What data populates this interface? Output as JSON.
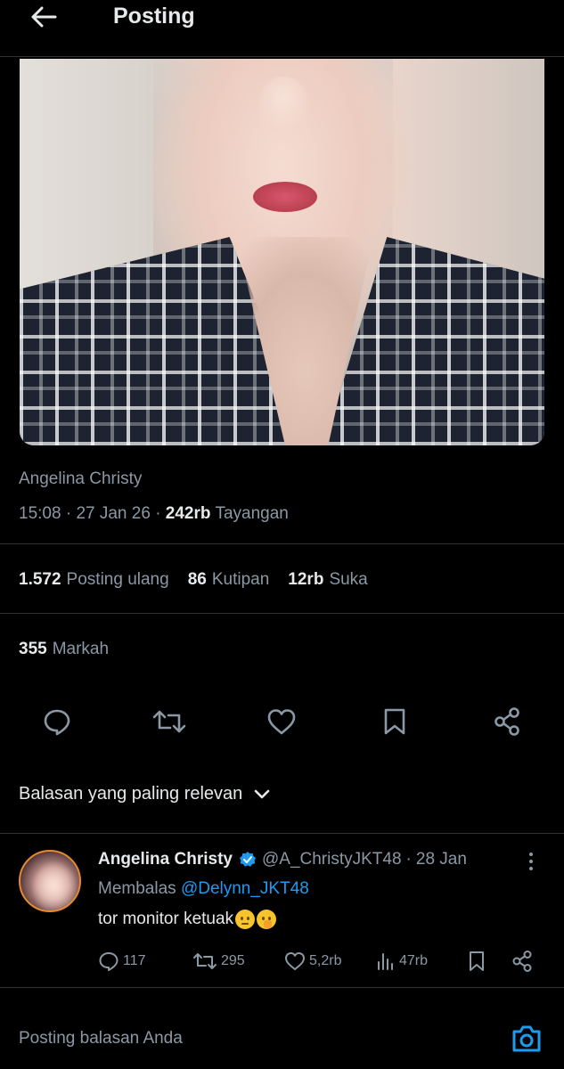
{
  "header": {
    "title": "Posting",
    "back_icon": "arrow-left-icon"
  },
  "post": {
    "author": "Angelina Christy",
    "time": "15:08",
    "date": "27 Jan 26",
    "separator": "·",
    "views_count": "242rb",
    "views_label": "Tayangan",
    "stats": [
      {
        "count": "1.572",
        "label": "Posting ulang"
      },
      {
        "count": "86",
        "label": "Kutipan"
      },
      {
        "count": "12rb",
        "label": "Suka"
      }
    ],
    "bookmarks": {
      "count": "355",
      "label": "Markah"
    },
    "actions": [
      "reply-icon",
      "repost-icon",
      "like-icon",
      "bookmark-icon",
      "share-icon"
    ]
  },
  "sort": {
    "label": "Balasan yang paling relevan",
    "icon": "chevron-down-icon"
  },
  "reply": {
    "name": "Angelina Christy",
    "handle": "@A_ChristyJKT48",
    "dot": "·",
    "date": "28 Jan",
    "replying_prefix": "Membalas",
    "replying_to": "@Delynn_JKT48",
    "text": "tor monitor ketuak",
    "actions": {
      "replies": "117",
      "reposts": "295",
      "likes": "5,2rb",
      "views": "47rb"
    }
  },
  "composer": {
    "placeholder": "Posting balasan Anda"
  },
  "colors": {
    "background": "#000000",
    "text": "#e7e9ea",
    "muted": "#8b98a5",
    "accent": "#1d9bf0",
    "divider": "#2f3336"
  }
}
